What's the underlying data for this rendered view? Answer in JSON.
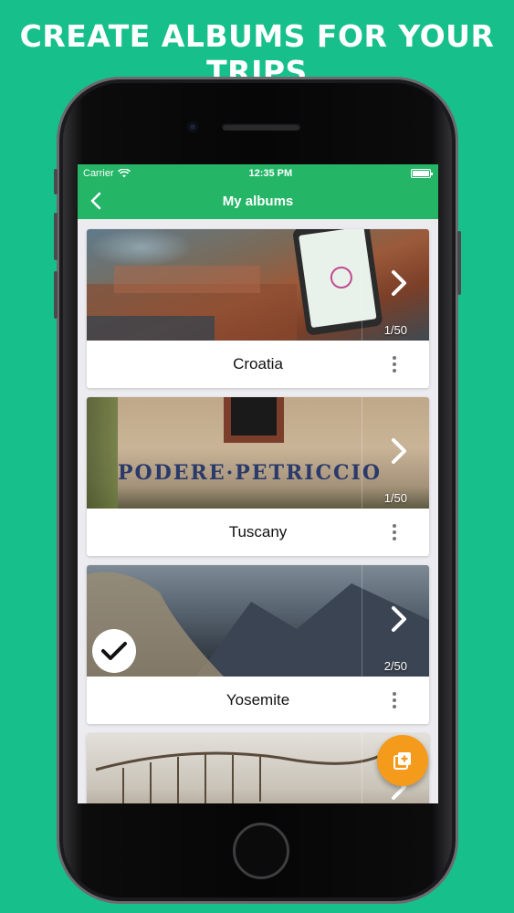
{
  "headline": "CREATE ALBUMS FOR YOUR TRIPS",
  "status_bar": {
    "carrier": "Carrier",
    "time": "12:35 PM"
  },
  "nav": {
    "title": "My albums",
    "back_icon": "chevron-left-icon"
  },
  "albums": [
    {
      "name": "Croatia",
      "count": "1/50",
      "selected": false
    },
    {
      "name": "Tuscany",
      "count": "1/50",
      "selected": false,
      "sign_text": "PODERE·PETRICCIO"
    },
    {
      "name": "Yosemite",
      "count": "2/50",
      "selected": true
    },
    {
      "name": "",
      "count": "",
      "selected": false
    }
  ],
  "colors": {
    "background": "#17c08a",
    "app_bar": "#24b567",
    "fab": "#f49b1c"
  },
  "fab_icon": "add-photo-icon"
}
